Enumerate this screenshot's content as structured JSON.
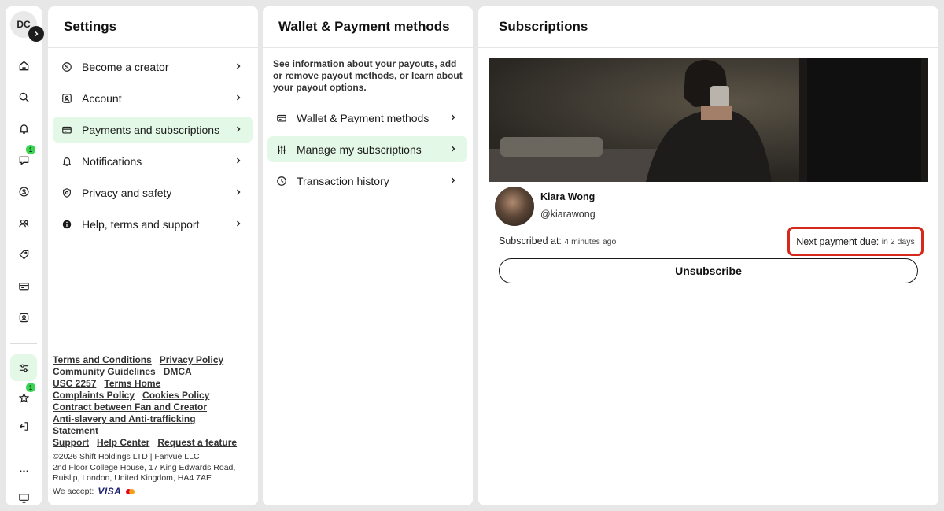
{
  "rail": {
    "user_initials": "DC",
    "items": [
      {
        "name": "home-icon"
      },
      {
        "name": "search-icon"
      },
      {
        "name": "bell-icon"
      },
      {
        "name": "messages-icon",
        "badge": "1"
      },
      {
        "name": "dollar-icon"
      },
      {
        "name": "people-icon"
      },
      {
        "name": "tag-icon"
      },
      {
        "name": "card-icon"
      },
      {
        "name": "profile-icon"
      },
      {
        "name": "settings-sliders-icon",
        "active": true
      },
      {
        "name": "star-icon",
        "badge": "1"
      },
      {
        "name": "logout-icon"
      },
      {
        "name": "more-icon"
      },
      {
        "name": "monitor-icon"
      }
    ]
  },
  "settings": {
    "title": "Settings",
    "items": [
      {
        "label": "Become a creator",
        "icon": "dollar-circle-icon"
      },
      {
        "label": "Account",
        "icon": "user-square-icon"
      },
      {
        "label": "Payments and subscriptions",
        "icon": "card-icon",
        "active": true
      },
      {
        "label": "Notifications",
        "icon": "bell-icon"
      },
      {
        "label": "Privacy and safety",
        "icon": "shield-search-icon"
      },
      {
        "label": "Help, terms and support",
        "icon": "info-icon"
      }
    ],
    "footer_links": {
      "terms": "Terms and Conditions",
      "privacy": "Privacy Policy",
      "community": "Community Guidelines",
      "dmca": "DMCA",
      "usc": "USC 2257",
      "terms_home": "Terms Home",
      "complaints": "Complaints Policy",
      "cookies": "Cookies Policy",
      "contract": "Contract between Fan and Creator",
      "anti_slavery": "Anti-slavery and Anti-trafficking Statement",
      "support": "Support",
      "help": "Help Center",
      "request": "Request a feature"
    },
    "copyright_line1": "©2026 Shift Holdings LTD | Fanvue LLC",
    "copyright_line2": "2nd Floor College House, 17 King Edwards Road, Ruislip, London, United Kingdom, HA4 7AE",
    "we_accept": "We accept:",
    "visa": "VISA"
  },
  "wallet": {
    "title": "Wallet & Payment methods",
    "description": "See information about your payouts, add or remove payout methods, or learn about your payout options.",
    "items": [
      {
        "label": "Wallet & Payment methods",
        "icon": "card-icon"
      },
      {
        "label": "Manage my subscriptions",
        "icon": "sliders-icon",
        "active": true
      },
      {
        "label": "Transaction history",
        "icon": "clock-icon"
      }
    ]
  },
  "subscriptions": {
    "title": "Subscriptions",
    "creator_name": "Kiara Wong",
    "creator_handle": "@kiarawong",
    "subscribed_label": "Subscribed at:",
    "subscribed_value": "4 minutes ago",
    "next_payment_label": "Next payment due:",
    "next_payment_value": "in 2 days",
    "unsubscribe_label": "Unsubscribe"
  },
  "colors": {
    "accent_green_bg": "#e3f8e6",
    "badge_green": "#39d353",
    "highlight_red": "#d32a1c"
  }
}
